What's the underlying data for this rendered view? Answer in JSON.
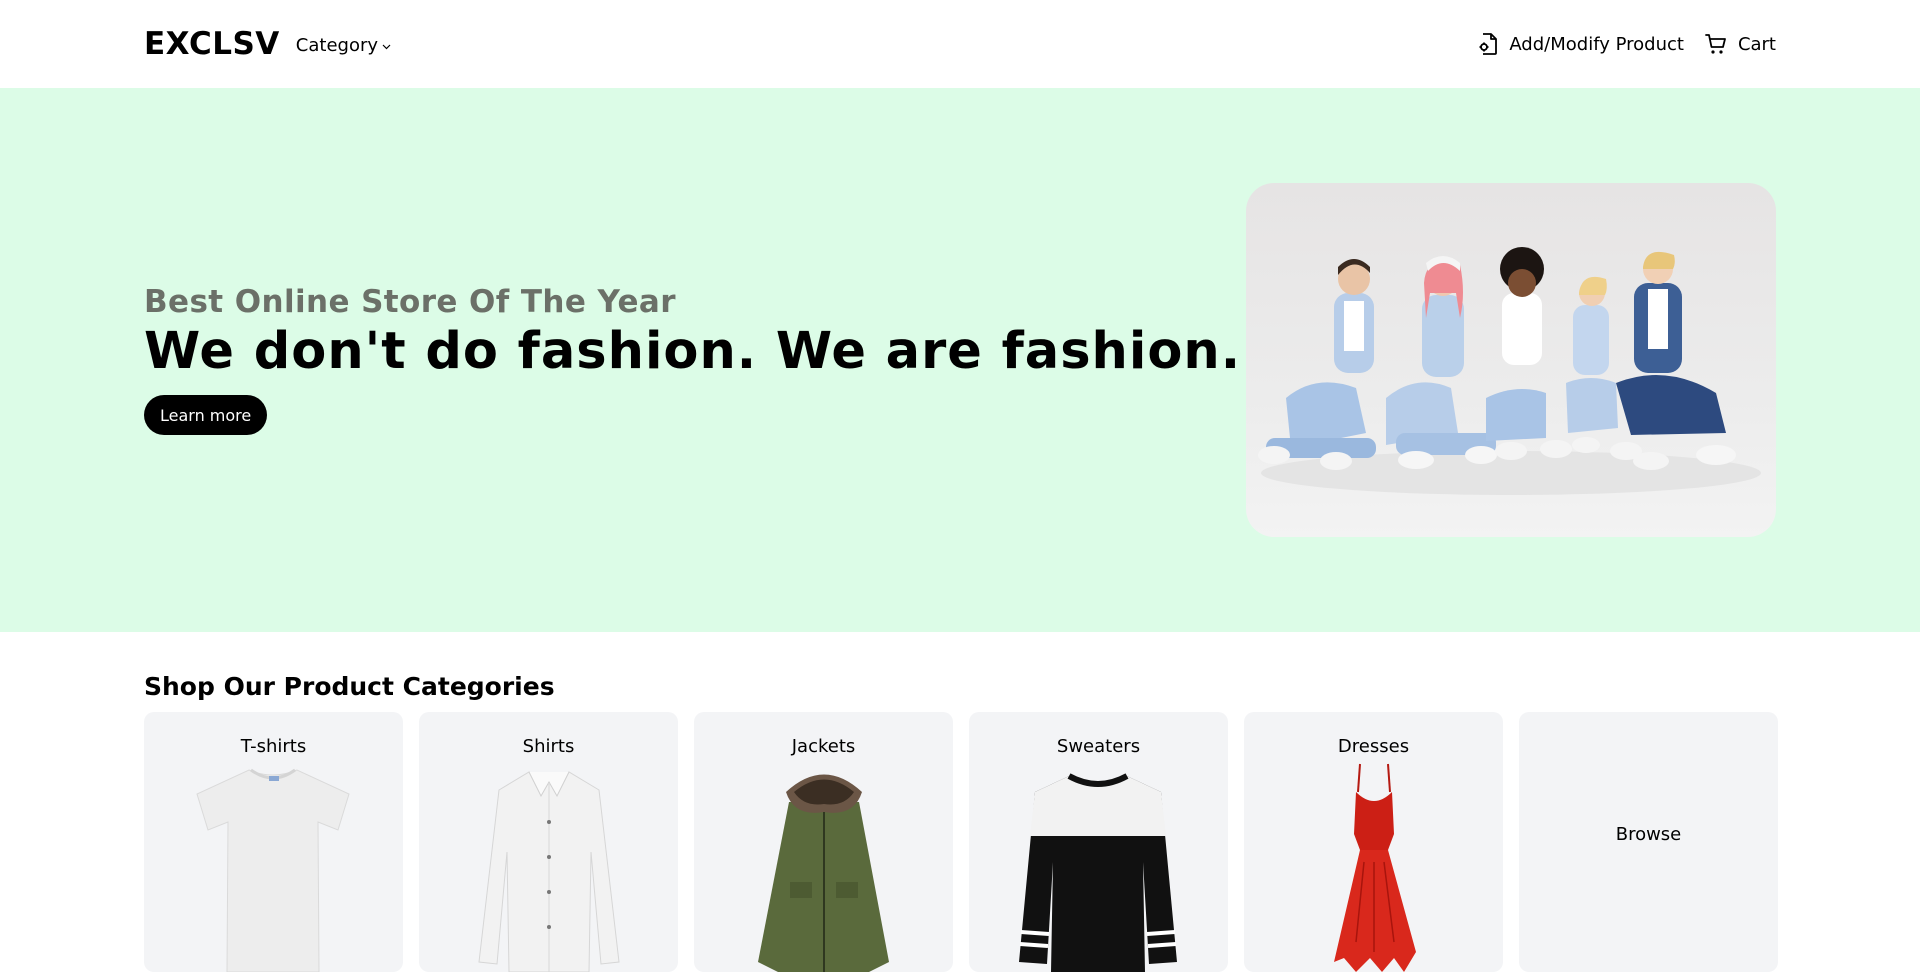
{
  "header": {
    "logo": "EXCLSV",
    "category_label": "Category",
    "add_modify_label": "Add/Modify Product",
    "cart_label": "Cart"
  },
  "hero": {
    "subtitle": "Best Online Store Of The Year",
    "title": "We don't do fashion. We are fashion.",
    "cta_label": "Learn more",
    "background_color": "#dcfce7"
  },
  "categories": {
    "heading": "Shop Our Product Categories",
    "items": [
      {
        "label": "T-shirts",
        "icon": "tshirt-image"
      },
      {
        "label": "Shirts",
        "icon": "shirt-image"
      },
      {
        "label": "Jackets",
        "icon": "jacket-image"
      },
      {
        "label": "Sweaters",
        "icon": "sweater-image"
      },
      {
        "label": "Dresses",
        "icon": "dress-image"
      },
      {
        "label": "Browse"
      }
    ]
  }
}
